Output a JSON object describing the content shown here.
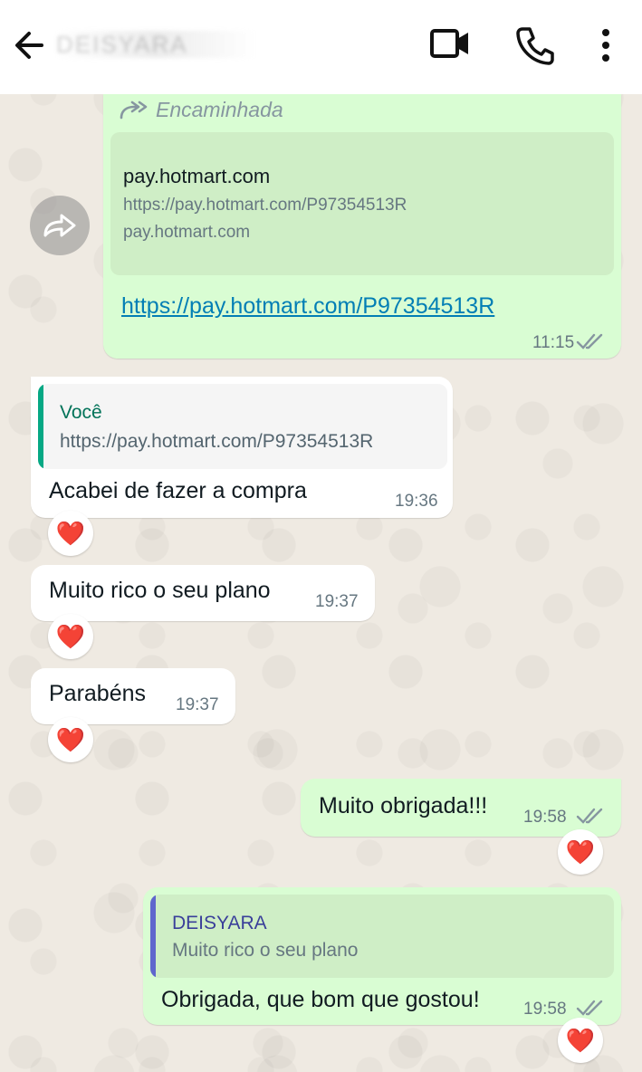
{
  "header": {
    "contact_name": "DEISYARA"
  },
  "messages": {
    "forwarded": {
      "label": "Encaminhada",
      "preview_title": "pay.hotmart.com",
      "preview_url": "https://pay.hotmart.com/P97354513R",
      "preview_domain": "pay.hotmart.com",
      "link": "https://pay.hotmart.com/P97354513R",
      "time": "11:15"
    },
    "reply_in": {
      "quote_author": "Você",
      "quote_text": "https://pay.hotmart.com/P97354513R",
      "text": "Acabei de fazer a compra",
      "time": "19:36",
      "reaction": "❤️"
    },
    "msg_plano": {
      "text": "Muito rico o seu plano",
      "time": "19:37",
      "reaction": "❤️"
    },
    "msg_parabens": {
      "text": "Parabéns",
      "time": "19:37",
      "reaction": "❤️"
    },
    "msg_obrigada": {
      "text": "Muito obrigada!!!",
      "time": "19:58",
      "reaction": "❤️"
    },
    "reply_out": {
      "quote_author": "DEISYARA",
      "quote_text": "Muito rico o seu plano",
      "text": "Obrigada, que bom que gostou!",
      "time": "19:58",
      "reaction": "❤️"
    }
  },
  "colors": {
    "outgoing_bubble": "#d9fdd3",
    "incoming_bubble": "#ffffff",
    "quote_bar_in": "#06a884",
    "quote_bar_out": "#5f66cd",
    "link": "#027eb5",
    "read_ticks": "#8696a0"
  }
}
